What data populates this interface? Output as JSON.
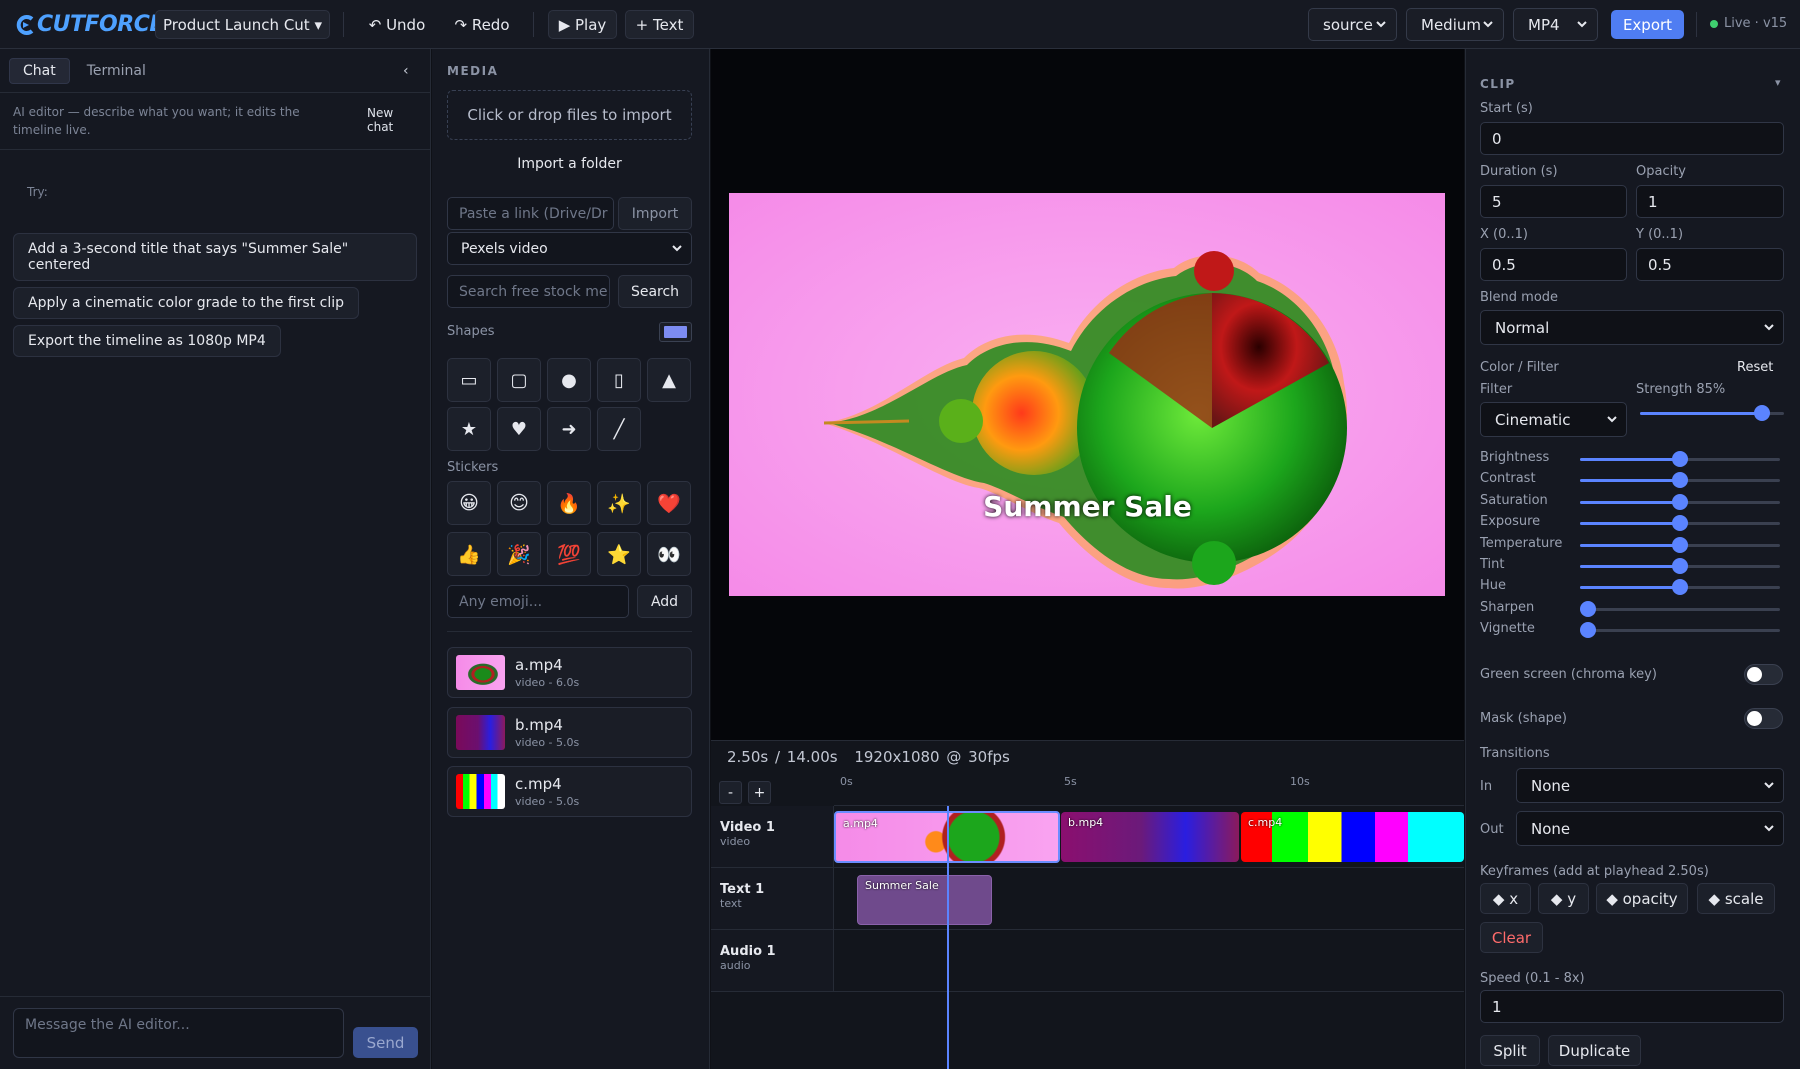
{
  "app": {
    "logo": "CUTFORCE",
    "project": "Product Launch Cut ▾"
  },
  "toolbar": {
    "undo": "↶ Undo",
    "redo": "↷ Redo",
    "play": "▶ Play",
    "text": "+ Text"
  },
  "export_opts": {
    "source": "source",
    "quality": "Medium",
    "format": "MP4",
    "export": "Export",
    "live": "Live · v15"
  },
  "chat": {
    "tabs": [
      "Chat",
      "Terminal"
    ],
    "collapse": "‹",
    "hint": "AI editor — describe what you want; it edits the timeline live.",
    "new_chat": "New chat",
    "try": "Try:",
    "suggestions": [
      "Add a 3-second title that says \"Summer Sale\" centered",
      "Apply a cinematic color grade to the first clip",
      "Export the timeline as 1080p MP4"
    ],
    "placeholder": "Message the AI editor...",
    "send": "Send"
  },
  "media": {
    "title": "MEDIA",
    "dropzone": "Click or drop files to import",
    "import_folder": "Import a folder",
    "link_placeholder": "Paste a link (Drive/Dr",
    "import": "Import",
    "source": "Pexels video",
    "search_placeholder": "Search free stock me",
    "search": "Search",
    "shapes_label": "Shapes",
    "shape_color": "#7d8cf2",
    "shapes": [
      "▭",
      "▢",
      "●",
      "▯",
      "▲",
      "★",
      "♥",
      "➜",
      "╱"
    ],
    "shape_names": [
      "rectangle-icon",
      "rounded-rect-icon",
      "circle-icon",
      "tall-rect-icon",
      "triangle-icon",
      "star-icon",
      "heart-icon",
      "arrow-icon",
      "line-icon"
    ],
    "stickers_label": "Stickers",
    "stickers": [
      "😀",
      "😊",
      "🔥",
      "✨",
      "❤️",
      "👍",
      "🎉",
      "💯",
      "⭐",
      "👀"
    ],
    "emoji_placeholder": "Any emoji...",
    "add": "Add",
    "assets": [
      {
        "name": "a.mp4",
        "meta": "video - 6.0s"
      },
      {
        "name": "b.mp4",
        "meta": "video - 5.0s"
      },
      {
        "name": "c.mp4",
        "meta": "video - 5.0s"
      }
    ]
  },
  "preview": {
    "overlay_text": "Summer Sale",
    "time": "2.50s / 14.00s",
    "resolution": "1920x1080 @ 30fps"
  },
  "timeline": {
    "zoom_out": "-",
    "zoom_in": "+",
    "ticks": [
      "0s",
      "5s",
      "10s"
    ],
    "tracks": [
      {
        "name": "Video 1",
        "type": "video"
      },
      {
        "name": "Text 1",
        "type": "text"
      },
      {
        "name": "Audio 1",
        "type": "audio"
      }
    ],
    "clips": {
      "a": "a.mp4",
      "b": "b.mp4",
      "c": "c.mp4",
      "text": "Summer Sale"
    }
  },
  "props": {
    "title": "CLIP",
    "collapse": "▾",
    "start_label": "Start (s)",
    "start": "0",
    "duration_label": "Duration (s)",
    "duration": "5",
    "opacity_label": "Opacity",
    "opacity": "1",
    "x_label": "X (0..1)",
    "x": "0.5",
    "y_label": "Y (0..1)",
    "y": "0.5",
    "blend_label": "Blend mode",
    "blend": "Normal",
    "color_label": "Color / Filter",
    "reset": "Reset",
    "filter_label": "Filter",
    "filter": "Cinematic",
    "strength_label": "Strength 85%",
    "strength": 0.85,
    "adjustments": [
      {
        "label": "Brightness",
        "value": 0.5
      },
      {
        "label": "Contrast",
        "value": 0.5
      },
      {
        "label": "Saturation",
        "value": 0.5
      },
      {
        "label": "Exposure",
        "value": 0.5
      },
      {
        "label": "Temperature",
        "value": 0.5
      },
      {
        "label": "Tint",
        "value": 0.5
      },
      {
        "label": "Hue",
        "value": 0.5
      },
      {
        "label": "Sharpen",
        "value": 0.0
      },
      {
        "label": "Vignette",
        "value": 0.0
      }
    ],
    "green_screen": "Green screen (chroma key)",
    "mask": "Mask (shape)",
    "transitions_label": "Transitions",
    "in_label": "In",
    "in": "None",
    "out_label": "Out",
    "out": "None",
    "keyframes_label": "Keyframes (add at playhead 2.50s)",
    "keyframes": [
      "◆ x",
      "◆ y",
      "◆ opacity",
      "◆ scale"
    ],
    "clear": "Clear",
    "speed_label": "Speed (0.1 - 8x)",
    "speed": "1",
    "split": "Split",
    "duplicate": "Duplicate"
  }
}
